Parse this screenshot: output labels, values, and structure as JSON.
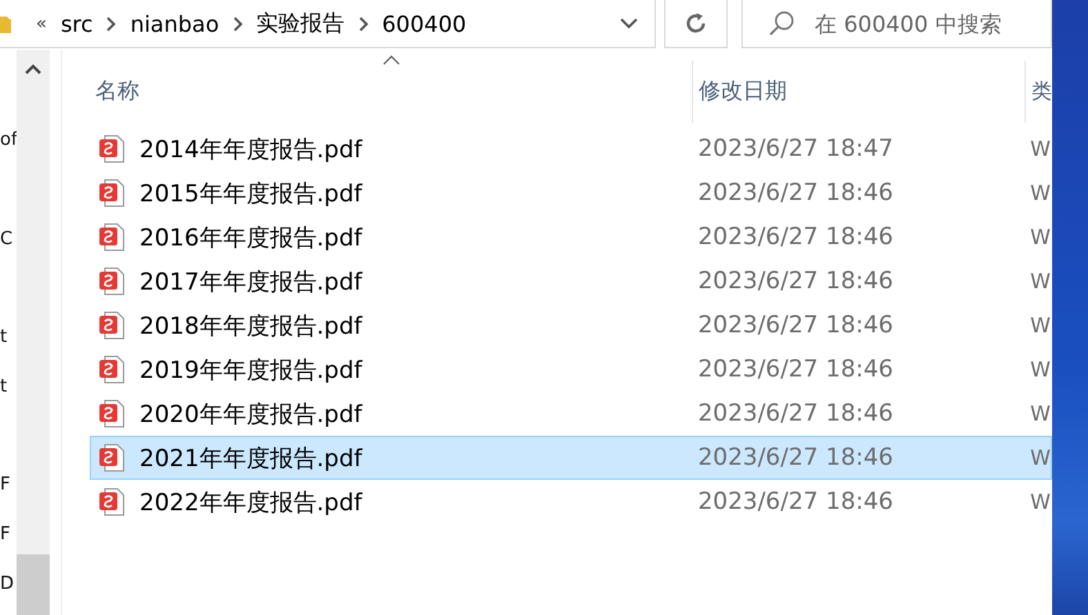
{
  "address_bar": {
    "overflow": "«",
    "path": [
      "src",
      "nianbao",
      "实验报告",
      "600400"
    ]
  },
  "search": {
    "placeholder": "在 600400 中搜索"
  },
  "nav_pane": {
    "items": [
      "of",
      "C",
      "t",
      "t",
      "F",
      "F",
      "D"
    ]
  },
  "columns": [
    {
      "label": "名称",
      "sorted": true
    },
    {
      "label": "修改日期",
      "sorted": false
    },
    {
      "label": "类",
      "sorted": false
    }
  ],
  "rows": [
    {
      "name": "2014年年度报告.pdf",
      "date": "2023/6/27 18:47",
      "type": "W",
      "selected": false
    },
    {
      "name": "2015年年度报告.pdf",
      "date": "2023/6/27 18:46",
      "type": "W",
      "selected": false
    },
    {
      "name": "2016年年度报告.pdf",
      "date": "2023/6/27 18:46",
      "type": "W",
      "selected": false
    },
    {
      "name": "2017年年度报告.pdf",
      "date": "2023/6/27 18:46",
      "type": "W",
      "selected": false
    },
    {
      "name": "2018年年度报告.pdf",
      "date": "2023/6/27 18:46",
      "type": "W",
      "selected": false
    },
    {
      "name": "2019年年度报告.pdf",
      "date": "2023/6/27 18:46",
      "type": "W",
      "selected": false
    },
    {
      "name": "2020年年度报告.pdf",
      "date": "2023/6/27 18:46",
      "type": "W",
      "selected": false
    },
    {
      "name": "2021年年度报告.pdf",
      "date": "2023/6/27 18:46",
      "type": "W",
      "selected": true
    },
    {
      "name": "2022年年度报告.pdf",
      "date": "2023/6/27 18:46",
      "type": "W",
      "selected": false
    }
  ]
}
